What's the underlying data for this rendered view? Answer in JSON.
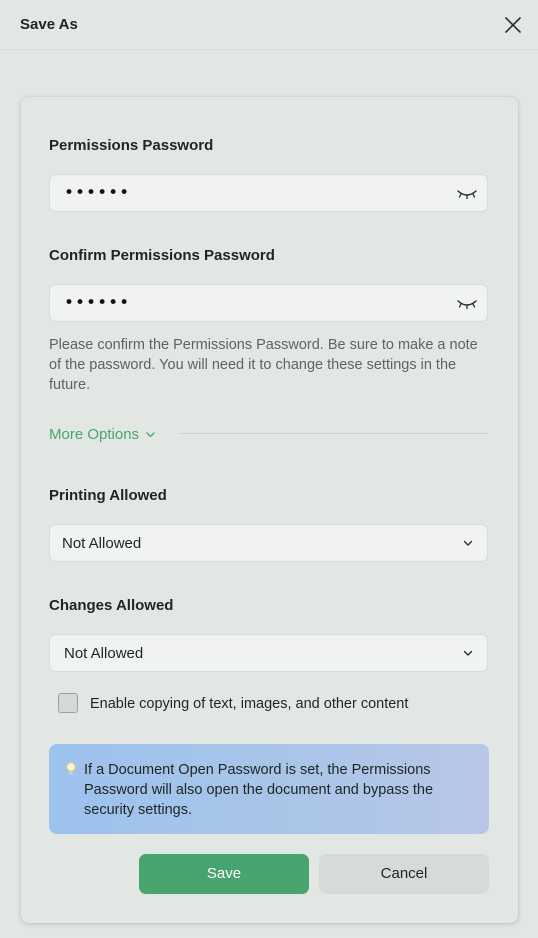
{
  "dialog": {
    "title": "Save As"
  },
  "permissions_password": {
    "label": "Permissions Password",
    "value": "••••••"
  },
  "confirm_password": {
    "label": "Confirm Permissions Password",
    "value": "••••••"
  },
  "help_text": "Please confirm the Permissions Password. Be sure to make a note of the password. You will need it to change these settings in the future.",
  "more_options": {
    "label": "More Options"
  },
  "printing": {
    "label": "Printing Allowed",
    "selected": "Not Allowed"
  },
  "changes": {
    "label": "Changes Allowed",
    "selected": "Not Allowed"
  },
  "copy_option": {
    "label": "Enable copying of text, images, and other content",
    "checked": false
  },
  "info": {
    "text": "If a Document Open Password is set, the Permissions Password will also open the document and bypass the security settings.",
    "icon": "lightbulb-icon"
  },
  "buttons": {
    "save": "Save",
    "cancel": "Cancel"
  },
  "colors": {
    "accent": "#48a46f",
    "link": "#49a56e",
    "info_start": "#9cc2ee",
    "info_end": "#b9c6e7"
  }
}
